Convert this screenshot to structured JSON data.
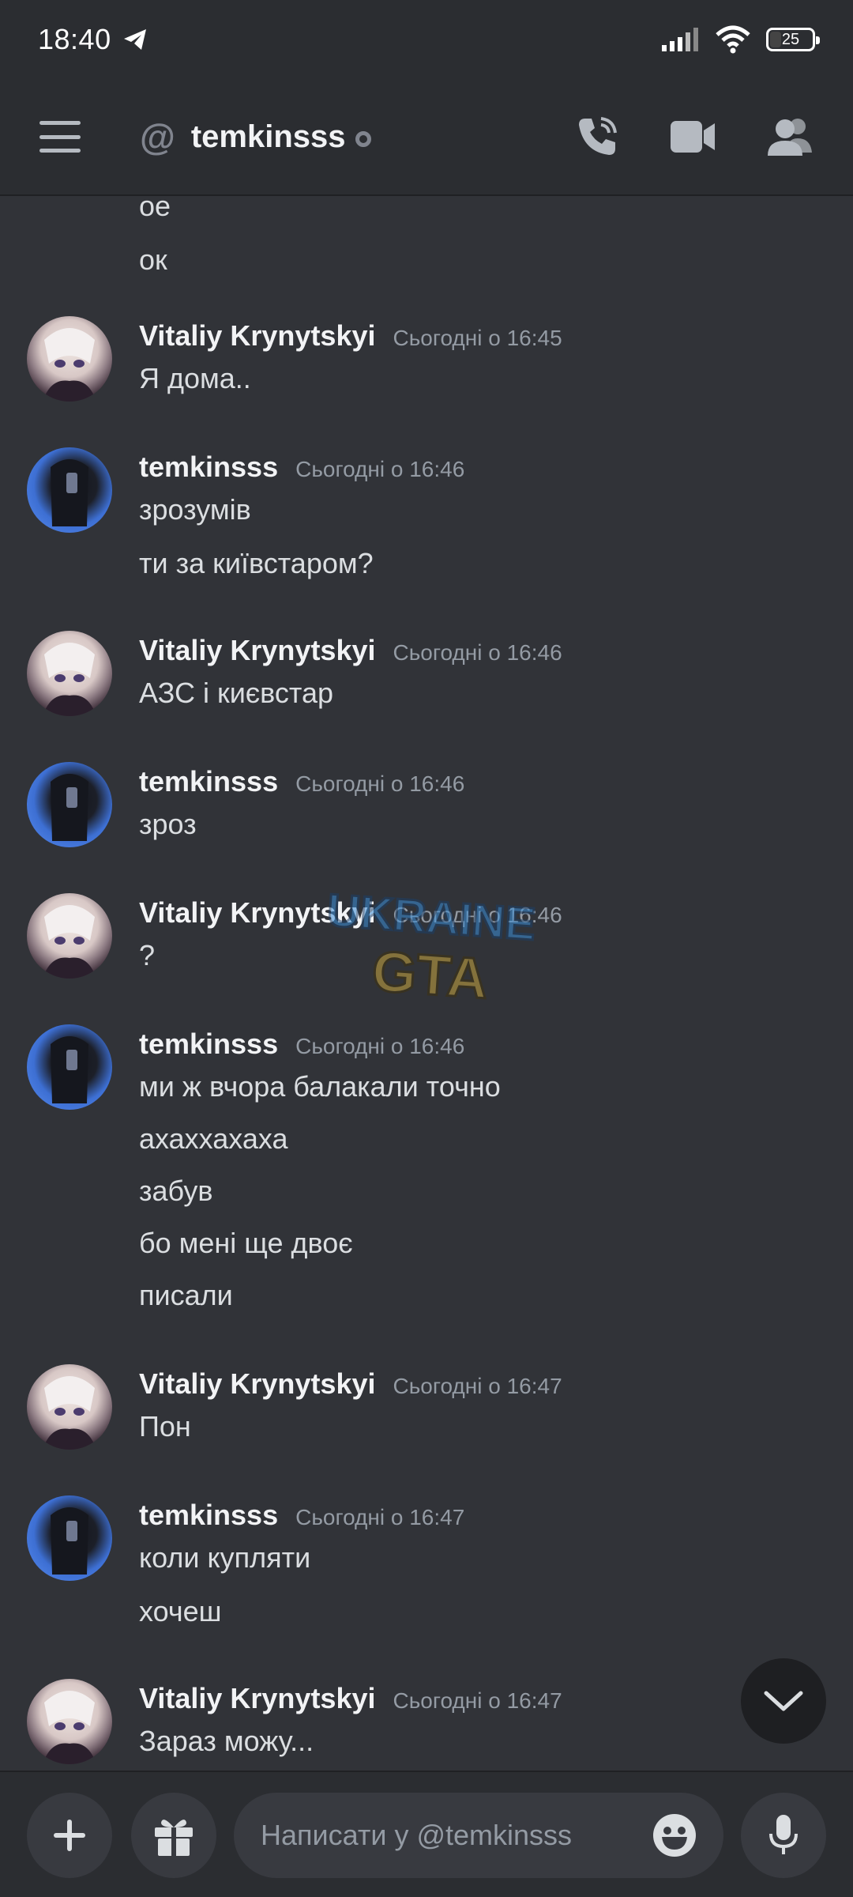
{
  "status_bar": {
    "time": "18:40",
    "battery": "25"
  },
  "header": {
    "channel_title": "temkinsss"
  },
  "messages": [
    {
      "author": "",
      "timestamp": "",
      "lines": [
        "ое",
        "ок"
      ]
    },
    {
      "author": "Vitaliy Krynytskyi",
      "timestamp": "Сьогодні о 16:45",
      "lines": [
        "Я дома.."
      ]
    },
    {
      "author": "temkinsss",
      "timestamp": "Сьогодні о 16:46",
      "lines": [
        "зрозумів",
        "ти за київстаром?"
      ]
    },
    {
      "author": "Vitaliy Krynytskyi",
      "timestamp": "Сьогодні о 16:46",
      "lines": [
        "АЗС і києвстар"
      ]
    },
    {
      "author": "temkinsss",
      "timestamp": "Сьогодні о 16:46",
      "lines": [
        "зроз"
      ]
    },
    {
      "author": "Vitaliy Krynytskyi",
      "timestamp": "Сьогодні о 16:46",
      "lines": [
        "?"
      ]
    },
    {
      "author": "temkinsss",
      "timestamp": "Сьогодні о 16:46",
      "lines": [
        "ми ж вчора балакали точно",
        "ахаххахаха",
        "забув",
        "бо мені ще двоє",
        "писали"
      ]
    },
    {
      "author": "Vitaliy Krynytskyi",
      "timestamp": "Сьогодні о 16:47",
      "lines": [
        "Пон"
      ]
    },
    {
      "author": "temkinsss",
      "timestamp": "Сьогодні о 16:47",
      "lines": [
        "коли купляти",
        "хочеш"
      ]
    },
    {
      "author": "Vitaliy Krynytskyi",
      "timestamp": "Сьогодні о 16:47",
      "lines": [
        "Зараз можу..."
      ]
    }
  ],
  "watermark": {
    "line1": "UKRAINE",
    "line2": "GTA"
  },
  "composer": {
    "placeholder": "Написати у @temkinsss"
  },
  "colors": {
    "background": "#313338",
    "header": "#2b2d31",
    "text": "#dbdee1",
    "muted": "#949ba4"
  },
  "icons": [
    "hamburger-icon",
    "at-icon",
    "phone-call-icon",
    "video-icon",
    "members-icon",
    "plus-icon",
    "gift-icon",
    "emoji-icon",
    "microphone-icon",
    "chevron-down-icon",
    "telegram-icon",
    "signal-icon",
    "wifi-icon",
    "battery-icon"
  ]
}
